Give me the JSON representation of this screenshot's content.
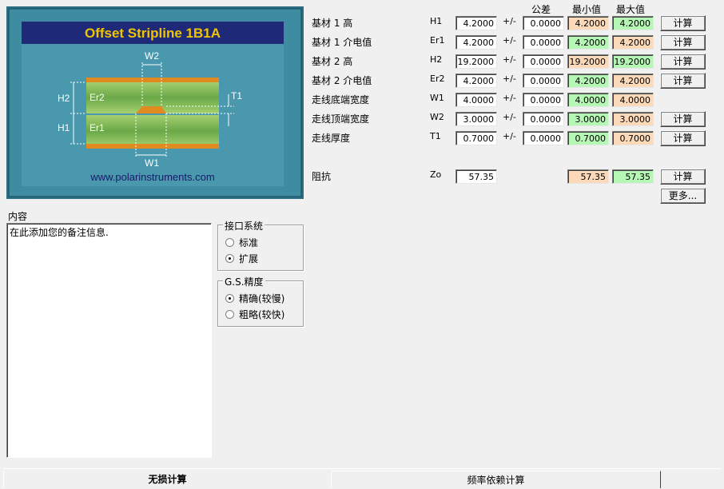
{
  "diagram": {
    "title": "Offset Stripline 1B1A",
    "url": "www.polarinstruments.com",
    "labels": {
      "w2": "W2",
      "w1": "W1",
      "t1": "T1",
      "h2": "H2",
      "h1": "H1",
      "er2": "Er2",
      "er1": "Er1"
    },
    "colors": {
      "background": "#2a6e84",
      "title_bar": "#1e2a78",
      "title_text": "#f0c400",
      "copper": "#e08a20",
      "dielectric": "#7ab050"
    }
  },
  "headers": {
    "tolerance": "公差",
    "min": "最小值",
    "max": "最大值"
  },
  "rows": [
    {
      "label": "基材 1 高",
      "symbol": "H1",
      "value": "4.2000",
      "pm": "+/-",
      "tolerance": "0.0000",
      "min": "4.2000",
      "max": "4.2000",
      "button": "计算"
    },
    {
      "label": "基材 1 介电值",
      "symbol": "Er1",
      "value": "4.2000",
      "pm": "+/-",
      "tolerance": "0.0000",
      "min": "4.2000",
      "max": "4.2000",
      "button": "计算"
    },
    {
      "label": "基材 2 高",
      "symbol": "H2",
      "value": "19.2000",
      "pm": "+/-",
      "tolerance": "0.0000",
      "min": "19.2000",
      "max": "19.2000",
      "button": "计算"
    },
    {
      "label": "基材 2 介电值",
      "symbol": "Er2",
      "value": "4.2000",
      "pm": "+/-",
      "tolerance": "0.0000",
      "min": "4.2000",
      "max": "4.2000",
      "button": "计算"
    },
    {
      "label": "走线底端宽度",
      "symbol": "W1",
      "value": "4.0000",
      "pm": "+/-",
      "tolerance": "0.0000",
      "min": "4.0000",
      "max": "4.0000",
      "button": ""
    },
    {
      "label": "走线顶端宽度",
      "symbol": "W2",
      "value": "3.0000",
      "pm": "+/-",
      "tolerance": "0.0000",
      "min": "3.0000",
      "max": "3.0000",
      "button": "计算"
    },
    {
      "label": "走线厚度",
      "symbol": "T1",
      "value": "0.7000",
      "pm": "+/-",
      "tolerance": "0.0000",
      "min": "0.7000",
      "max": "0.7000",
      "button": "计算"
    }
  ],
  "impedance": {
    "label": "阻抗",
    "symbol": "Zo",
    "value": "57.35",
    "min": "57.35",
    "max": "57.35",
    "button": "计算"
  },
  "more_button": "更多...",
  "notes": {
    "label": "内容",
    "text": "在此添加您的备注信息."
  },
  "interface_group": {
    "title": "接口系统",
    "options": [
      "标准",
      "扩展"
    ],
    "selected": "扩展"
  },
  "precision_group": {
    "title": "G.S.精度",
    "options": [
      "精确(较慢)",
      "粗略(较快)"
    ],
    "selected": "精确(较慢)"
  },
  "tabs": {
    "lossless": "无损计算",
    "freq": "频率依赖计算"
  },
  "field_colors": {
    "min_peach": "#fcd9b8",
    "max_green": "#b6f7b6",
    "min_green": "#b6f7b6",
    "max_peach": "#fcd9b8"
  }
}
